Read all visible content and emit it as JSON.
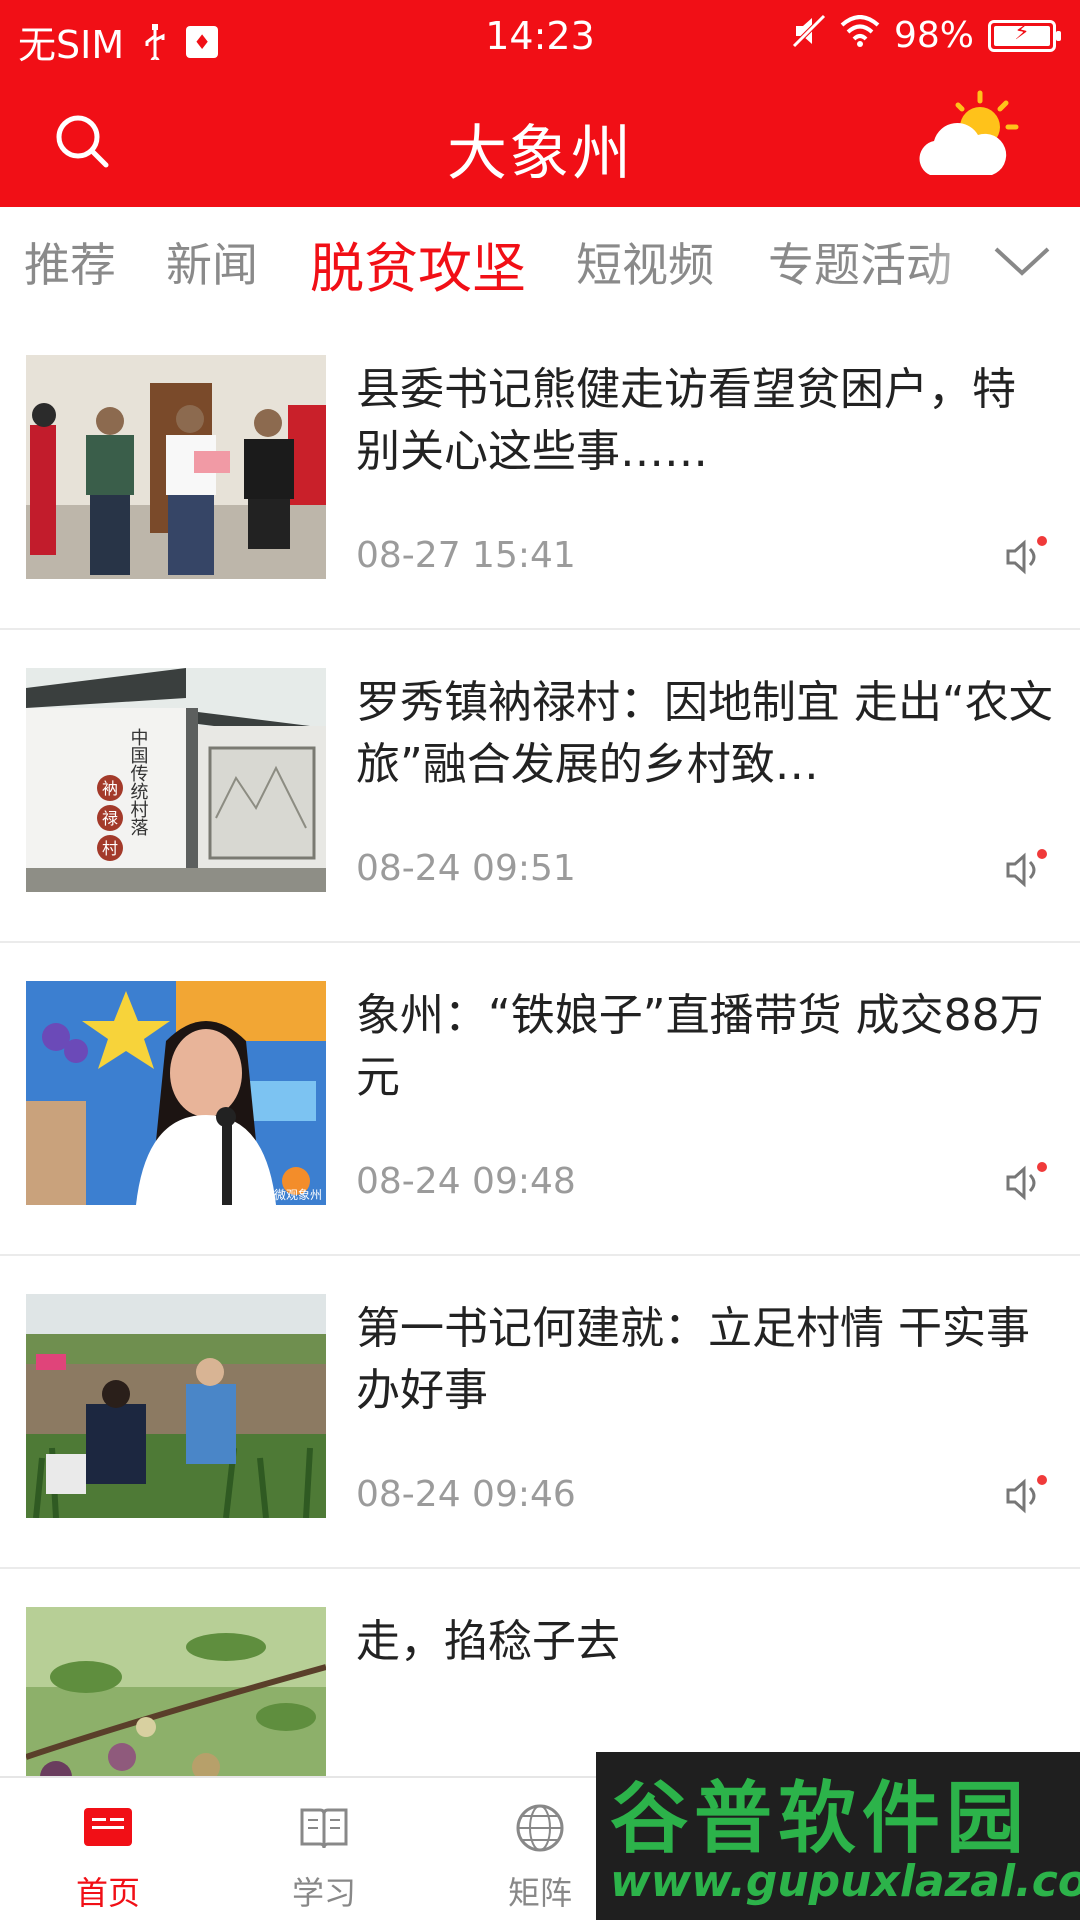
{
  "status_bar": {
    "carrier": "无SIM",
    "time": "14:23",
    "battery": "98%"
  },
  "header": {
    "title": "大象州",
    "search_icon": "search-icon",
    "weather_icon": "sun-cloud-icon"
  },
  "tabs": [
    {
      "label": "推荐",
      "active": false
    },
    {
      "label": "新闻",
      "active": false
    },
    {
      "label": "脱贫攻坚",
      "active": true
    },
    {
      "label": "短视频",
      "active": false
    },
    {
      "label": "专题活动",
      "active": false
    }
  ],
  "articles": [
    {
      "title": "县委书记熊健走访看望贫困户，特别关心这些事……",
      "time": "08-27 15:41"
    },
    {
      "title": "罗秀镇衲禄村：因地制宜 走出“农文旅”融合发展的乡村致…",
      "time": "08-24 09:51",
      "thumb_text": "中国传统村落",
      "thumb_seal": [
        "衲",
        "禄",
        "村"
      ]
    },
    {
      "title": "象州：“铁娘子”直播带货 成交88万元",
      "time": "08-24 09:48",
      "thumb_text": "微观象州"
    },
    {
      "title": "第一书记何建就：立足村情 干实事 办好事",
      "time": "08-24 09:46"
    },
    {
      "title": "走，掐稔子去",
      "time": ""
    }
  ],
  "bottom_nav": [
    {
      "label": "首页",
      "icon": "news-home-icon",
      "active": true
    },
    {
      "label": "学习",
      "icon": "book-icon",
      "active": false
    },
    {
      "label": "矩阵",
      "icon": "globe-icon",
      "active": false
    }
  ],
  "watermark": {
    "title": "谷普软件园",
    "url": "www.gupuxlazal.com"
  },
  "colors": {
    "brand": "#f10f16",
    "text_dark": "#222222",
    "text_muted": "#9b9b9b"
  }
}
